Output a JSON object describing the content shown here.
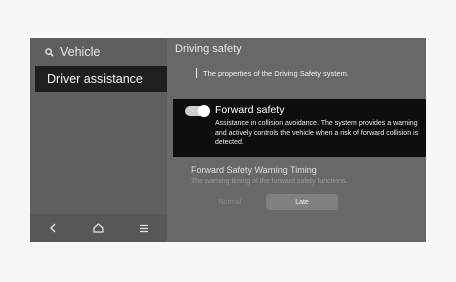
{
  "sidebar": {
    "search_label": "Vehicle",
    "items": [
      {
        "label": "Driver assistance",
        "selected": true
      }
    ],
    "bottom_icons": [
      "back-icon",
      "home-icon",
      "menu-icon"
    ]
  },
  "main": {
    "title": "Driving safety",
    "description": "The properties of the Driving Safety system.",
    "forward_safety": {
      "title": "Forward safety",
      "enabled": true,
      "description": "Assistance in collision avoidance. The system provides a warning and actively controls the vehicle when a risk of  forward collision is detected."
    },
    "warning_timing": {
      "title": "Forward Safety Warning Timing",
      "description": "The warning timing of the forward safety functions.",
      "options": [
        "Normal",
        "Late"
      ],
      "selected": "Late"
    }
  }
}
